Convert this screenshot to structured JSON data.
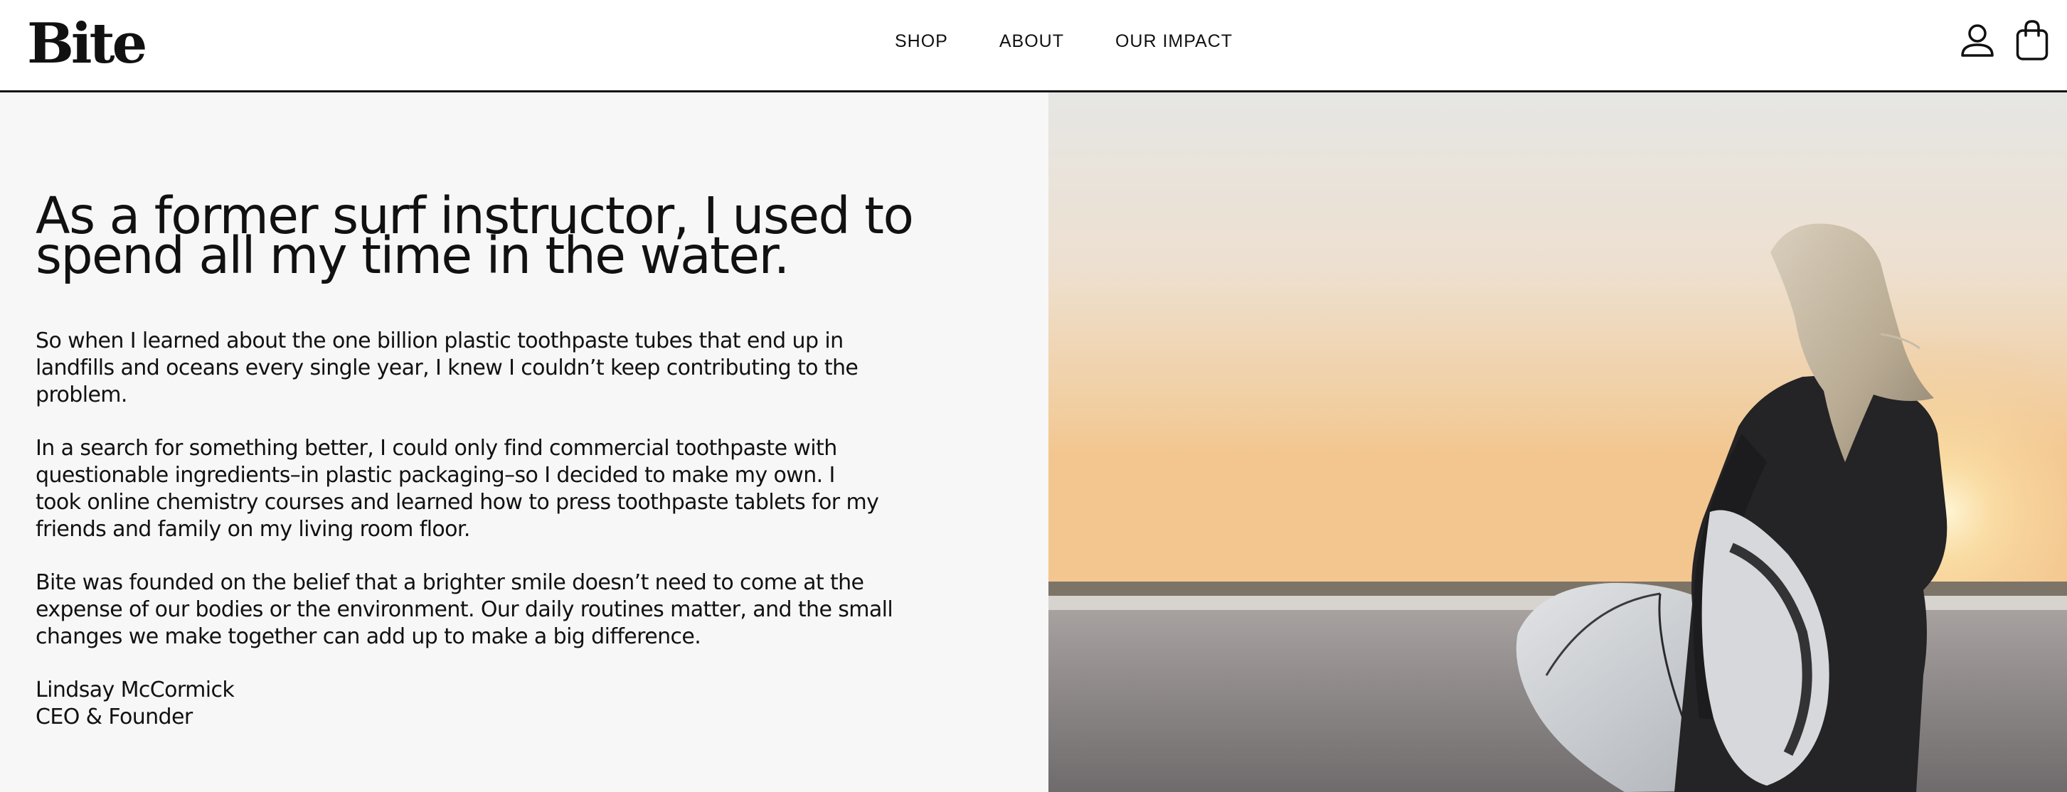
{
  "header": {
    "logo": "Bite",
    "nav": [
      {
        "label": "SHOP"
      },
      {
        "label": "ABOUT"
      },
      {
        "label": "OUR IMPACT"
      }
    ],
    "icons": [
      "account-icon",
      "shopping-bag-icon"
    ]
  },
  "story": {
    "headline_lines": [
      "As a former surf instructor, I used to",
      "spend all my time in the water."
    ],
    "paragraphs": [
      {
        "lines": [
          "So when I learned about the one billion plastic toothpaste tubes that end up in",
          "landfills and oceans every single year, I knew I couldn’t keep contributing to the",
          "problem."
        ]
      },
      {
        "lines": [
          "In a search for something better, I could only find commercial toothpaste with",
          "questionable ingredients–in plastic packaging–so I decided to make my own. I",
          "took online chemistry courses and learned how to press toothpaste tablets for my",
          "friends and family on my living room floor."
        ]
      },
      {
        "lines": [
          "Bite was founded on the belief that a brighter smile doesn’t need to come at the",
          "expense of our bodies or the environment. Our daily routines matter, and the small",
          "changes we make together can add up to make a big difference."
        ]
      }
    ],
    "signature": {
      "name": "Lindsay McCormick",
      "title": "CEO & Founder"
    }
  },
  "colors": {
    "text": "#111111",
    "story_background": "#f7f7f7",
    "header_background": "#ffffff",
    "divider": "#111111"
  }
}
